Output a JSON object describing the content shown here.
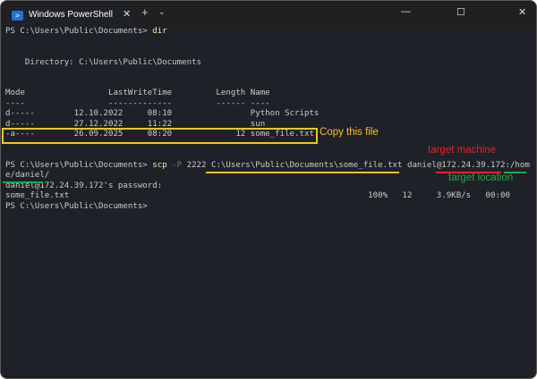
{
  "window": {
    "tab_title": "Windows PowerShell",
    "new_tab": "+",
    "dropdown": "⌄",
    "tab_close": "✕",
    "minimize": "—",
    "maximize": "☐",
    "close": "✕",
    "icon": "powershell-icon"
  },
  "terminal": {
    "lines": [
      [
        {
          "t": "PS C:\\Users\\Public\\Documents> "
        },
        {
          "t": "dir",
          "c": "y"
        }
      ],
      [],
      [],
      [
        {
          "t": "    Directory: C:\\Users\\Public\\Documents"
        }
      ],
      [],
      [],
      [
        {
          "t": "Mode                 LastWriteTime         Length Name"
        }
      ],
      [
        {
          "t": "----                 -------------         ------ ----"
        }
      ],
      [
        {
          "t": "d-----        12.10.2022     08:10                Python Scripts"
        }
      ],
      [
        {
          "t": "d-----        27.12.2022     11:22                sun"
        }
      ],
      [
        {
          "t": "-a----        26.09.2025     08:20             12 some_file.txt"
        }
      ],
      [],
      [],
      [
        {
          "t": "PS C:\\Users\\Public\\Documents> "
        },
        {
          "t": "scp",
          "c": "y"
        },
        {
          "t": " -P",
          "c": "g"
        },
        {
          "t": " 2222 C:\\Users\\Public\\Documents\\some_file.txt daniel@172.24.39.172:/hom"
        }
      ],
      [
        {
          "t": "e/daniel/"
        }
      ],
      [
        {
          "t": "daniel@172.24.39.172's password:"
        }
      ],
      [
        {
          "t": "some_file.txt                                                             100%   12     3.9KB/s   00:00"
        }
      ],
      [
        {
          "t": "PS C:\\Users\\Public\\Documents>"
        }
      ]
    ]
  },
  "annotations": {
    "copy_label": "Copy this file",
    "machine_label": "target machine",
    "location_label": "target location",
    "yellow": "#f5c518",
    "red": "#e8202a",
    "green": "#1faa4a"
  }
}
